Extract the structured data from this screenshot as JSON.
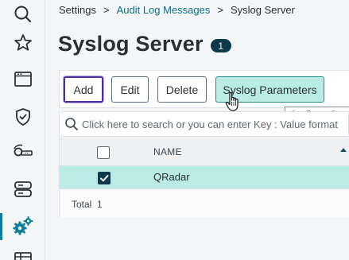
{
  "breadcrumb": {
    "items": [
      "Settings",
      "Audit Log Messages",
      "Syslog Server"
    ],
    "separator": ">"
  },
  "page": {
    "title": "Syslog Server",
    "count": "1"
  },
  "toolbar": {
    "add_label": "Add",
    "edit_label": "Edit",
    "delete_label": "Delete",
    "params_label": "Syslog Parameters"
  },
  "tooltip": {
    "text": "Configure Sys"
  },
  "search": {
    "placeholder": "Click here to search or you can enter Key : Value format"
  },
  "table": {
    "columns": [
      "NAME"
    ],
    "rows": [
      {
        "name": "QRadar",
        "selected": true
      }
    ],
    "total_text": "Total  1"
  },
  "sidebar": {
    "icons": [
      "search-icon",
      "star-icon",
      "window-icon",
      "shield-check-icon",
      "key-icon",
      "server-icon",
      "settings-gears-icon",
      "table-icon"
    ],
    "active": "settings-gears-icon"
  },
  "colors": {
    "accent": "#0a7e9a",
    "selected_row": "#b9ece6",
    "badge": "#0c3a4a",
    "focus": "#4f2f9e"
  }
}
